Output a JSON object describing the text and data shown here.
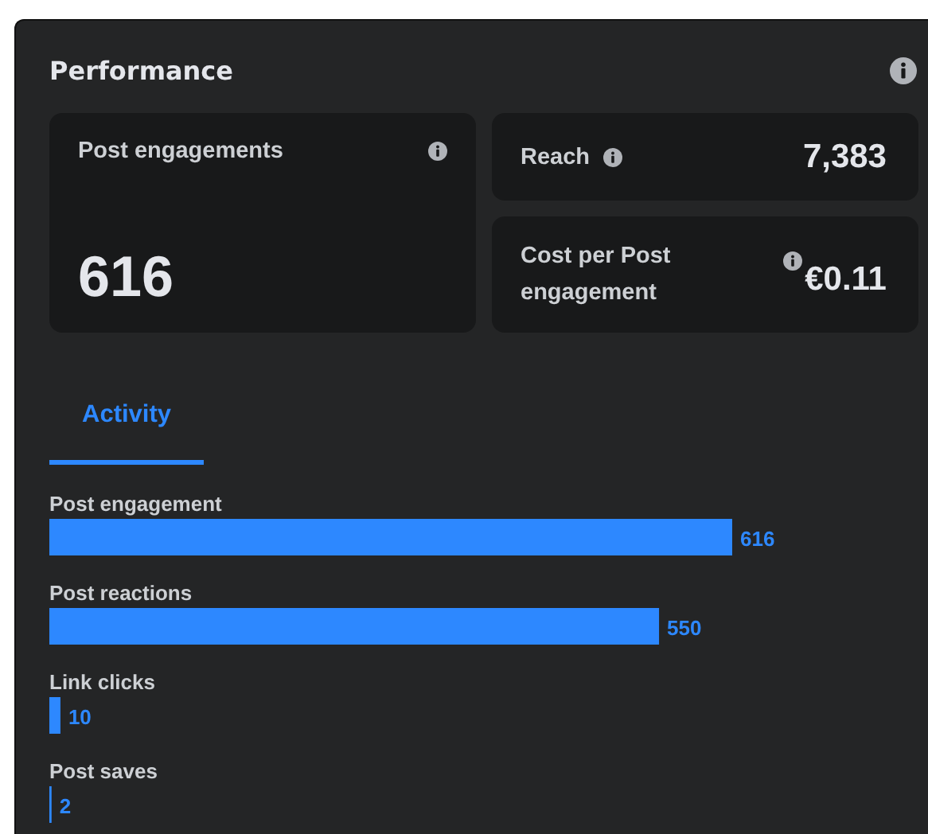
{
  "panel": {
    "title": "Performance"
  },
  "metrics": [
    {
      "label": "Post engagements",
      "value": "616",
      "kind": "large"
    },
    {
      "label": "Reach",
      "value": "7,383",
      "kind": "inline"
    },
    {
      "label": "Cost per Post engagement",
      "value": "€0.11",
      "kind": "compact"
    }
  ],
  "tabs": [
    {
      "label": "Activity",
      "selected": true
    }
  ],
  "activity": {
    "chart_data": {
      "type": "bar",
      "orientation": "horizontal",
      "categories": [
        "Post engagement",
        "Post reactions",
        "Link clicks",
        "Post saves"
      ],
      "values": [
        616,
        550,
        10,
        2
      ],
      "data_labels": true
    }
  }
}
